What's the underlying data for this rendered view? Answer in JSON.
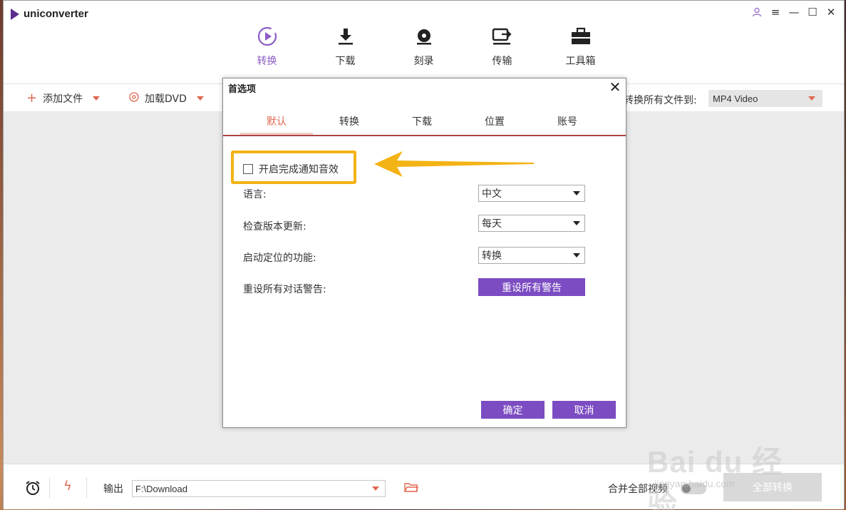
{
  "app": {
    "name": "uniconverter"
  },
  "nav": [
    {
      "label": "转换",
      "icon": "play-circle-icon"
    },
    {
      "label": "下载",
      "icon": "download-icon"
    },
    {
      "label": "刻录",
      "icon": "disc-icon"
    },
    {
      "label": "传输",
      "icon": "transfer-icon"
    },
    {
      "label": "工具箱",
      "icon": "toolbox-icon"
    }
  ],
  "toolbar": {
    "add_file": "添加文件",
    "load_dvd": "加载DVD",
    "convert_all_to": "转换所有文件到:",
    "format": "MP4 Video"
  },
  "dialog": {
    "title": "首选项",
    "tabs": [
      "默认",
      "转换",
      "下载",
      "位置",
      "账号"
    ],
    "active_tab": "默认",
    "notify_sound": {
      "label": "开启完成通知音效",
      "checked": false
    },
    "language": {
      "label": "语言:",
      "value": "中文"
    },
    "check_update": {
      "label": "检查版本更新:",
      "value": "每天"
    },
    "startup_function": {
      "label": "启动定位的功能:",
      "value": "转换"
    },
    "reset_warnings": {
      "label": "重设所有对话警告:",
      "button": "重设所有警告"
    },
    "ok": "确定",
    "cancel": "取消"
  },
  "bottom": {
    "output_label": "输出",
    "output_path": "F:\\Download",
    "merge_label": "合并全部视频",
    "convert_all_button": "全部转换"
  },
  "watermark": {
    "brand": "Bai du 经验",
    "url": "jingyan.baidu.com"
  },
  "colors": {
    "accent": "#7b4cc2",
    "tab_active": "#e0674f",
    "highlight": "#f3b315"
  }
}
